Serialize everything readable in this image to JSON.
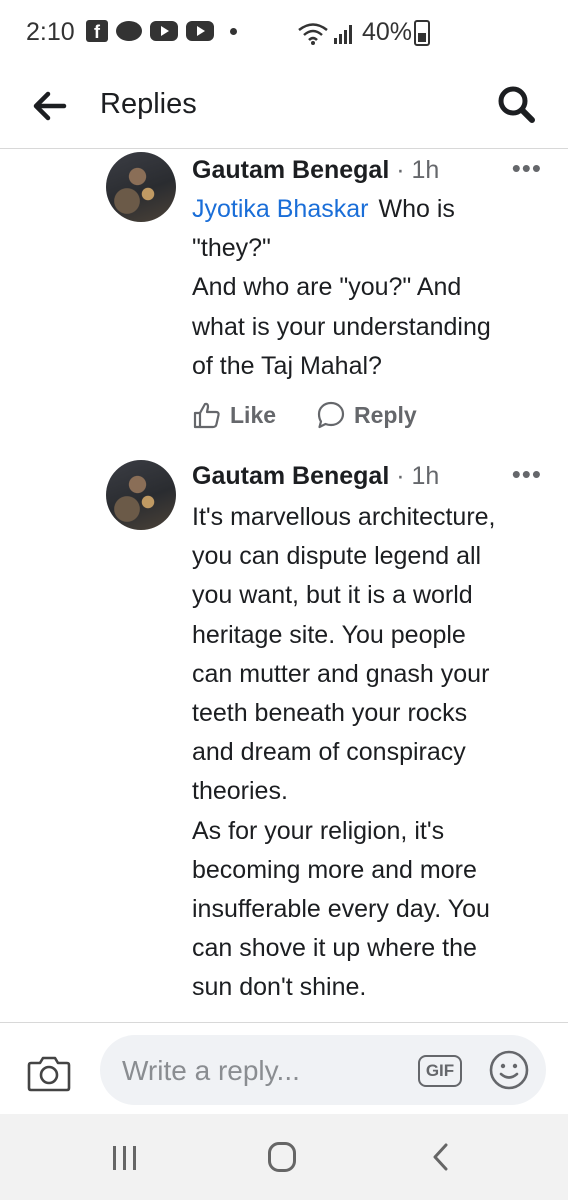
{
  "status_bar": {
    "time": "2:10",
    "battery": "40%",
    "icons": [
      "facebook-icon",
      "chat-icon",
      "youtube-icon",
      "youtube-icon",
      "notification-dot",
      "wifi-icon",
      "signal-icon",
      "battery-icon"
    ]
  },
  "header": {
    "title": "Replies",
    "icons": [
      "back-arrow-icon",
      "search-icon"
    ]
  },
  "comments": [
    {
      "author": "Gautam Benegal",
      "time": "· 1h",
      "mention": "Jyotika Bhaskar",
      "body_lines": [
        "Who is",
        "\"they?\"",
        "And who are \"you?\" And",
        "what is your understanding",
        "of the Taj Mahal?"
      ],
      "more": "•••",
      "like_label": "Like",
      "reply_label": "Reply"
    },
    {
      "author": "Gautam Benegal",
      "time": "· 1h",
      "body_lines": [
        "It's marvellous architecture,",
        "you can dispute legend all",
        "you want, but it is a world",
        "heritage site. You people",
        "can mutter and gnash your",
        "teeth beneath your rocks",
        "and dream of conspiracy",
        "theories.",
        "As for your religion, it's",
        "becoming more and more",
        "insufferable every day. You",
        "can shove it up where the",
        "sun don't shine."
      ],
      "more": "•••"
    }
  ],
  "composer": {
    "placeholder": "Write a reply...",
    "gif_label": "GIF",
    "icons": [
      "camera-icon",
      "gif-icon",
      "emoji-icon"
    ]
  },
  "nav_bar": {
    "icons": [
      "recents-icon",
      "home-icon",
      "back-icon"
    ]
  },
  "colors": {
    "mention": "#1a6ed8",
    "text": "#1c1e21",
    "secondary": "#65676b",
    "input_bg": "#f0f2f5",
    "nav_bg": "#f2f2f2"
  }
}
